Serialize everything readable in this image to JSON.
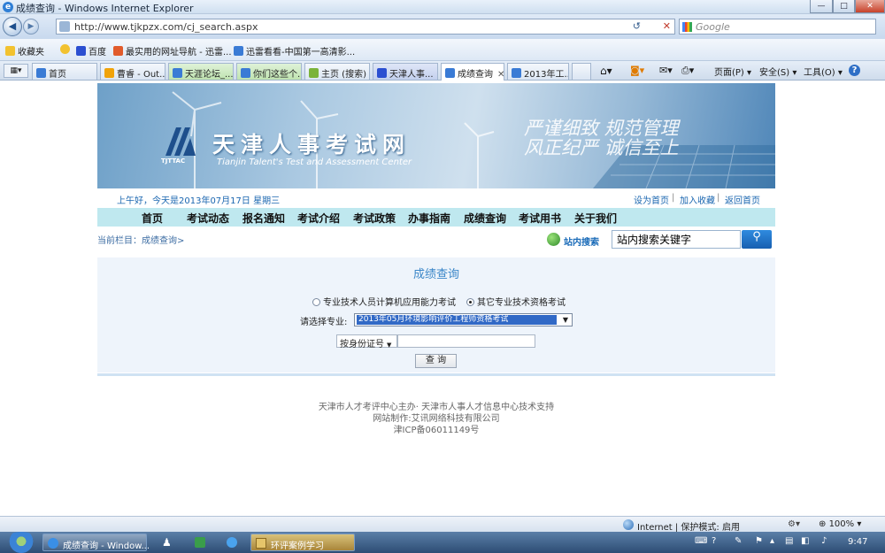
{
  "window": {
    "title": "成绩查询 - Windows Internet Explorer",
    "ie_glyph": "e",
    "min": "—",
    "max": "□",
    "close": "✕"
  },
  "addressbar": {
    "url": "http://www.tjkpzx.com/cj_search.aspx",
    "search_placeholder": "Google",
    "back": "◀",
    "forward": "▶",
    "refresh": "↺",
    "stop": "✕"
  },
  "favorites": {
    "label": "收藏夹",
    "items": [
      "百度",
      "最实用的网址导航 - 迅雷...",
      "迅雷看看-中国第一高清影..."
    ]
  },
  "tabs": [
    "首页",
    "曹睿 - Out...",
    "天涯论坛_...",
    "你们这些个...",
    "主页 (搜索)",
    "天津人事...",
    "成绩查询",
    "2013年工..."
  ],
  "commands": {
    "page": "页面(P) ▾",
    "safety": "安全(S) ▾",
    "tools": "工具(O) ▾",
    "help": "?"
  },
  "site": {
    "banner_title": "天津人事考试网",
    "banner_sub": "Tianjin Talent's Test and Assessment Center",
    "banner_abbr": "TJTTAC",
    "slogan1": "严谨细致  规范管理",
    "slogan2": "风正纪严  诚信至上",
    "greeting": "上午好，今天是2013年07月17日 星期三",
    "links": [
      "设为首页",
      "加入收藏",
      "返回首页"
    ],
    "menu": [
      "首页",
      "考试动态",
      "报名通知",
      "考试介绍",
      "考试政策",
      "办事指南",
      "成绩查询",
      "考试用书",
      "关于我们"
    ],
    "breadcrumb": "当前栏目：成绩查询>",
    "site_search_label": "站内搜索",
    "site_search_placeholder": "站内搜索关键字",
    "search_btn_icon": "⚲"
  },
  "form": {
    "title": "成绩查询",
    "radio1": "专业技术人员计算机应用能力考试",
    "radio2": "其它专业技术资格考试",
    "major_label": "请选择专业:",
    "major_value": "2013年05月环境影响评价工程师资格考试",
    "id_type": "按身份证号",
    "query_button": "查 询"
  },
  "footer": {
    "line1": "天津市人才考评中心主办· 天津市人事人才信息中心技术支持",
    "line2": "网站制作:艾讯网络科技有限公司",
    "line3": "津ICP备06011149号"
  },
  "status": {
    "zone": "Internet | 保护模式: 启用",
    "zoom": "100%"
  },
  "taskbar": {
    "items": [
      "成绩查询 - Window...",
      "环评案例学习"
    ],
    "time": "9:47"
  }
}
